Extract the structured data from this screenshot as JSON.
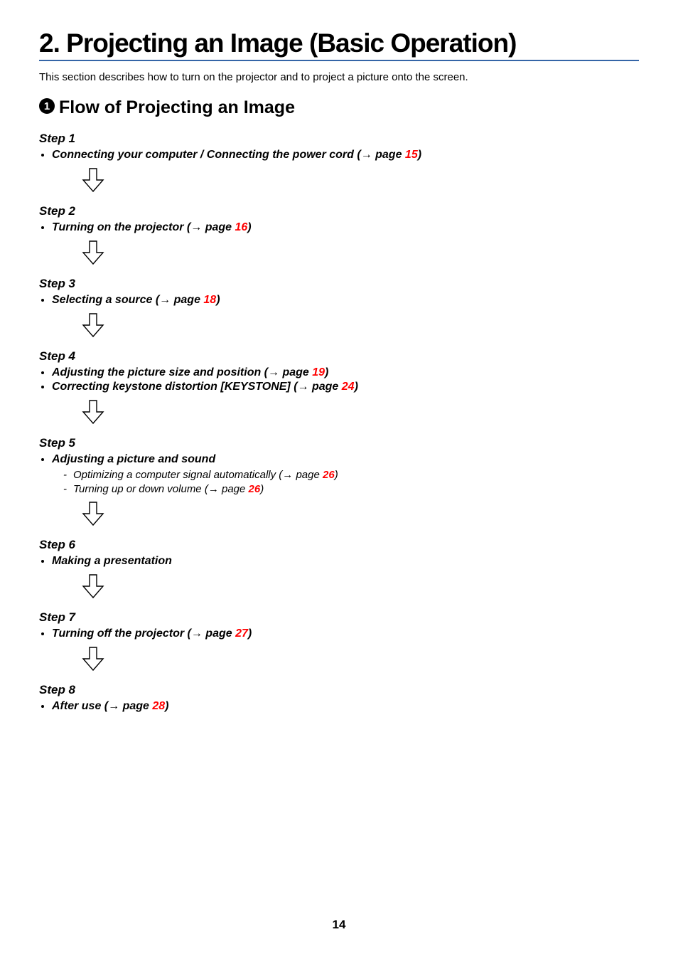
{
  "chapter_title": "2. Projecting an Image (Basic Operation)",
  "intro": "This section describes how to turn on the projector and to project a picture onto the screen.",
  "section_number": "1",
  "section_heading": "Flow of Projecting an Image",
  "labels": {
    "page": " page "
  },
  "page_number": "14",
  "steps": [
    {
      "title": "Step 1",
      "items": [
        {
          "pre": "Connecting your computer / Connecting the power cord (",
          "page": "15",
          "post": ")"
        }
      ]
    },
    {
      "title": "Step 2",
      "items": [
        {
          "pre": "Turning on the projector (",
          "page": "16",
          "post": ")"
        }
      ]
    },
    {
      "title": "Step 3",
      "items": [
        {
          "pre": "Selecting a source (",
          "page": "18",
          "post": ")"
        }
      ]
    },
    {
      "title": "Step 4",
      "items": [
        {
          "pre": "Adjusting the picture size and position (",
          "page": "19",
          "post": ")"
        },
        {
          "pre": "Correcting keystone distortion [KEYSTONE] (",
          "page": "24",
          "post": ")"
        }
      ]
    },
    {
      "title": "Step 5",
      "items": [
        {
          "pre": "Adjusting a picture and sound",
          "subs": [
            {
              "pre": "Optimizing a computer signal automatically (",
              "page": "26",
              "post": ")"
            },
            {
              "pre": "Turning up or down volume (",
              "page": "26",
              "post": ")"
            }
          ]
        }
      ]
    },
    {
      "title": "Step 6",
      "items": [
        {
          "pre": "Making a presentation"
        }
      ]
    },
    {
      "title": "Step 7",
      "items": [
        {
          "pre": "Turning off the projector (",
          "page": "27",
          "post": ")"
        }
      ]
    },
    {
      "title": "Step 8",
      "items": [
        {
          "pre": "After use (",
          "page": "28",
          "post": ")"
        }
      ]
    }
  ]
}
